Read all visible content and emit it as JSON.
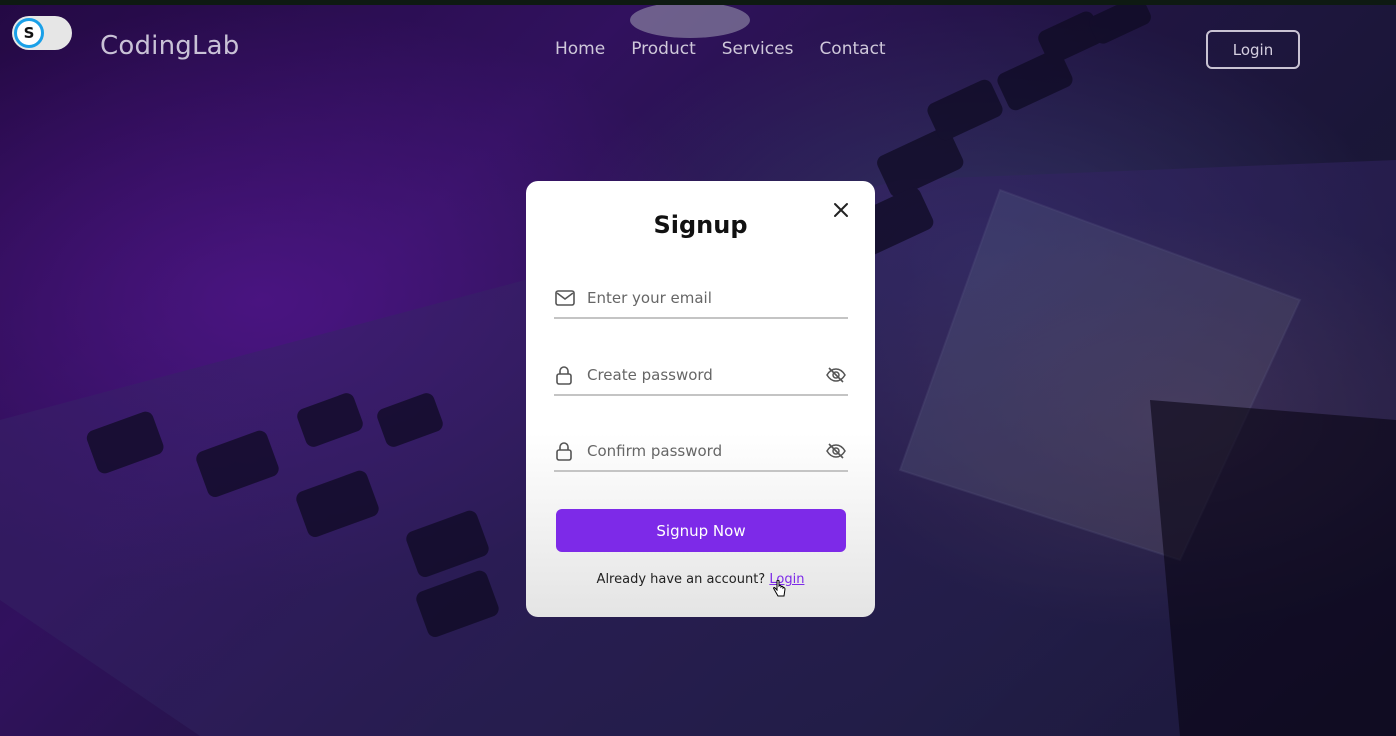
{
  "header": {
    "logo": "CodingLab",
    "nav": [
      {
        "label": "Home"
      },
      {
        "label": "Product"
      },
      {
        "label": "Services"
      },
      {
        "label": "Contact"
      }
    ],
    "login_label": "Login"
  },
  "toggle": {
    "letter": "S"
  },
  "modal": {
    "title": "Signup",
    "email_placeholder": "Enter your email",
    "password_placeholder": "Create password",
    "confirm_placeholder": "Confirm password",
    "submit_label": "Signup Now",
    "footer_text": "Already have an account?",
    "footer_link": "Login"
  },
  "colors": {
    "accent": "#7d2ae8",
    "toggle_ring": "#1aa0e8"
  },
  "icons": {
    "email": "envelope-icon",
    "password": "lock-icon",
    "eye": "eye-slash-icon",
    "close": "close-icon"
  }
}
